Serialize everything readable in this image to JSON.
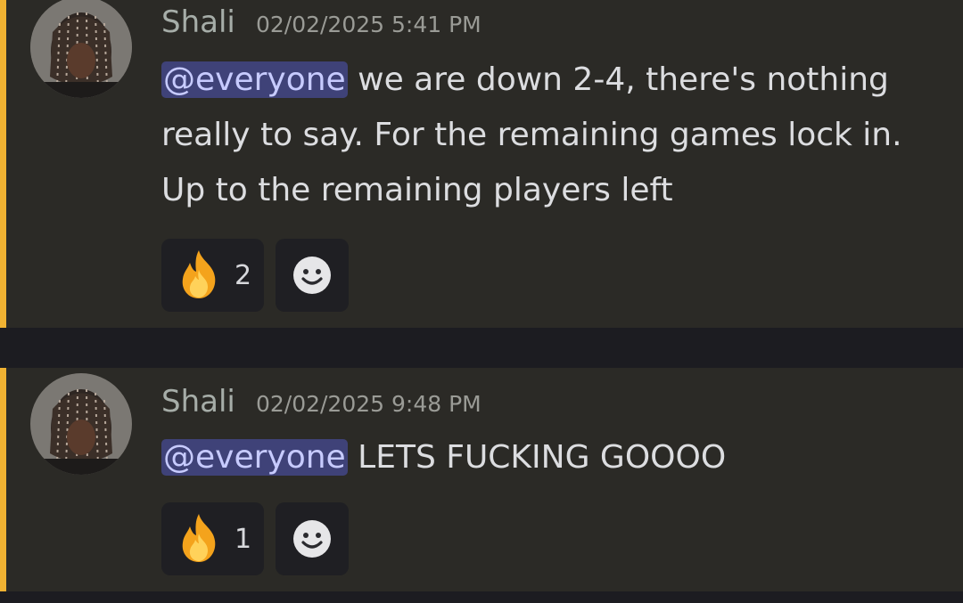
{
  "messages": [
    {
      "username": "Shali",
      "timestamp": "02/02/2025 5:41 PM",
      "mention": "@everyone",
      "text": " we are down 2-4, there's nothing really to say. For the remaining games lock in. Up to the remaining players left",
      "reaction": {
        "icon": "fire-emoji",
        "count": "2"
      },
      "add_reaction_icon": "smiley-add-reaction-icon"
    },
    {
      "username": "Shali",
      "timestamp": "02/02/2025 9:48 PM",
      "mention": "@everyone",
      "text": " LETS FUCKING GOOOO",
      "reaction": {
        "icon": "fire-emoji",
        "count": "1"
      },
      "add_reaction_icon": "smiley-add-reaction-icon"
    }
  ],
  "colors": {
    "highlight_bar": "#f0b232",
    "message_bg": "#2b2a26",
    "separator_bg": "#1c1c21",
    "mention_bg": "#3f4278",
    "mention_text": "#c7cbff"
  }
}
